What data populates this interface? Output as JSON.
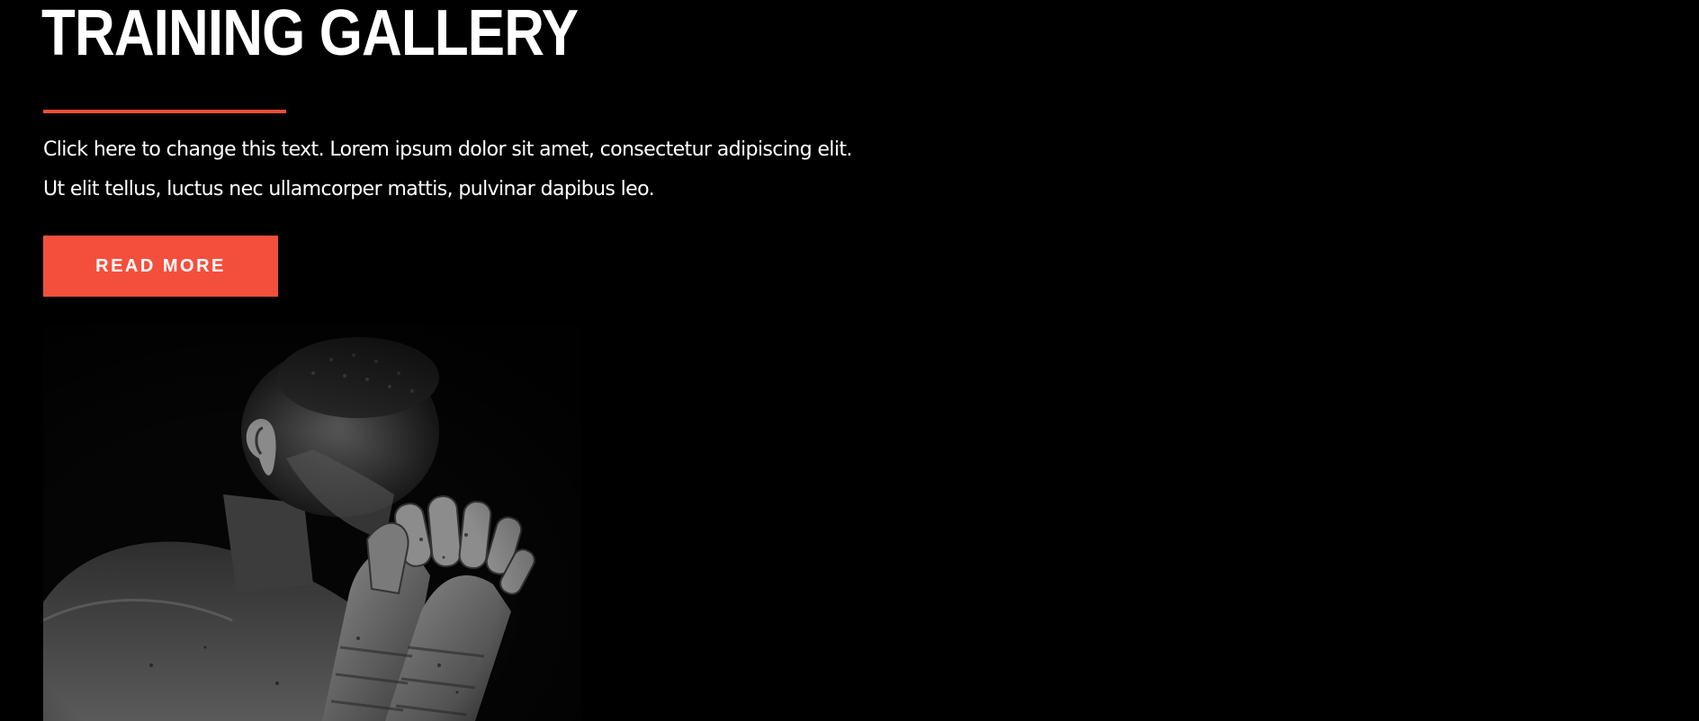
{
  "section": {
    "title": "TRAINING GALLERY",
    "description": "Click here to change this text. Lorem ipsum dolor sit amet, consectetur adipiscing elit. Ut elit tellus, luctus nec ullamcorper mattis, pulvinar dapibus leo.",
    "button_label": "READ MORE"
  },
  "colors": {
    "background": "#000000",
    "accent": "#f44f3d",
    "text": "#ffffff"
  },
  "image": {
    "subject": "boxer-with-wrapped-hands-photo"
  }
}
